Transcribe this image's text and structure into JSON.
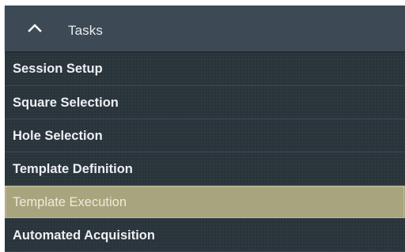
{
  "panel": {
    "title": "Tasks",
    "collapse_icon": "chevron-up-icon",
    "colors": {
      "header_bg": "#3d4954",
      "list_bg": "#29333a",
      "selected_bg": "#a8a47d",
      "text": "#edf0f2"
    }
  },
  "tasks": [
    {
      "label": "Session Setup",
      "selected": false
    },
    {
      "label": "Square Selection",
      "selected": false
    },
    {
      "label": "Hole Selection",
      "selected": false
    },
    {
      "label": "Template Definition",
      "selected": false
    },
    {
      "label": "Template Execution",
      "selected": true
    },
    {
      "label": "Automated Acquisition",
      "selected": false
    }
  ]
}
